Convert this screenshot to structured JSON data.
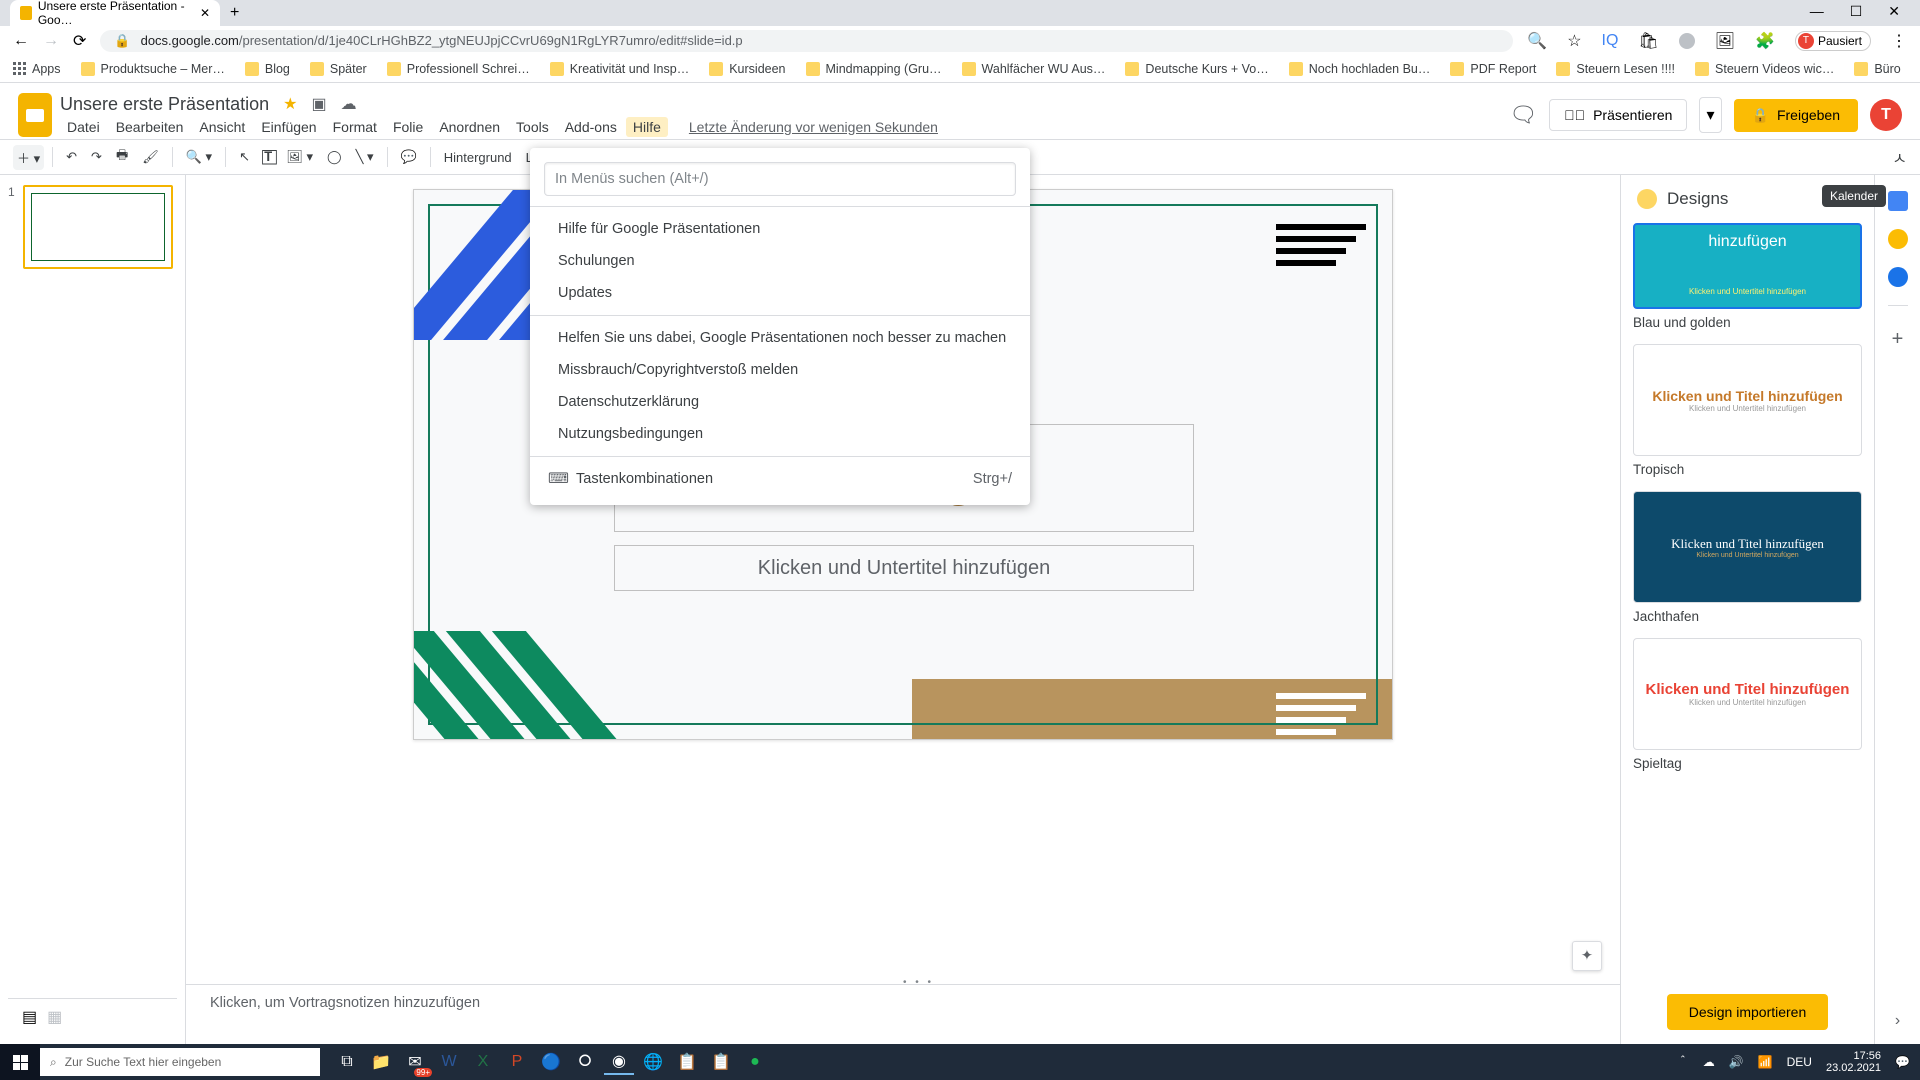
{
  "browser": {
    "tab_title": "Unsere erste Präsentation - Goo…",
    "url_prefix": "docs.google.com",
    "url_path": "/presentation/d/1je40CLrHGhBZ2_ytgNEUJpjCCvrU69gN1RgLYR7umro/edit#slide=id.p",
    "profile_label": "Pausiert",
    "window_min": "—",
    "window_max": "☐",
    "window_close": "✕"
  },
  "bookmarks": {
    "apps": "Apps",
    "items": [
      "Produktsuche – Mer…",
      "Blog",
      "Später",
      "Professionell Schrei…",
      "Kreativität und Insp…",
      "Kursideen",
      "Mindmapping (Gru…",
      "Wahlfächer WU Aus…",
      "Deutsche Kurs + Vo…",
      "Noch hochladen Bu…",
      "PDF Report",
      "Steuern Lesen !!!!",
      "Steuern Videos wic…",
      "Büro"
    ]
  },
  "doc": {
    "title": "Unsere erste Präsentation",
    "last_edit": "Letzte Änderung vor wenigen Sekunden"
  },
  "menubar": {
    "file": "Datei",
    "edit": "Bearbeiten",
    "view": "Ansicht",
    "insert": "Einfügen",
    "format": "Format",
    "slide": "Folie",
    "arrange": "Anordnen",
    "tools": "Tools",
    "addons": "Add-ons",
    "help": "Hilfe"
  },
  "header_actions": {
    "present": "Präsentieren",
    "share": "Freigeben"
  },
  "toolbar": {
    "background": "Hintergrund",
    "layout": "Layout"
  },
  "help_menu": {
    "search_placeholder": "In Menüs suchen (Alt+/)",
    "help_docs": "Hilfe für Google Präsentationen",
    "training": "Schulungen",
    "updates": "Updates",
    "improve": "Helfen Sie uns dabei, Google Präsentationen noch besser zu machen",
    "report": "Missbrauch/Copyrightverstoß melden",
    "privacy": "Datenschutzerklärung",
    "terms": "Nutzungsbedingungen",
    "shortcuts": "Tastenkombinationen",
    "shortcuts_key": "Strg+/"
  },
  "slide": {
    "title_placeholder": "hinzufügen",
    "subtitle_placeholder": "Klicken und Untertitel hinzufügen"
  },
  "notes": {
    "placeholder": "Klicken, um Vortragsnotizen hinzuzufügen"
  },
  "filmstrip": {
    "slide1_num": "1"
  },
  "designs": {
    "title": "Designs",
    "import": "Design importieren",
    "tooltip": "Kalender",
    "themes": [
      {
        "name": "Blau und golden",
        "title_text": "hinzufügen",
        "sub_text": "Klicken und Untertitel hinzufügen"
      },
      {
        "name": "Tropisch",
        "title_text": "Klicken und Titel hinzufügen",
        "sub_text": "Klicken und Untertitel hinzufügen"
      },
      {
        "name": "Jachthafen",
        "title_text": "Klicken und Titel hinzufügen",
        "sub_text": "Klicken und Untertitel hinzufügen"
      },
      {
        "name": "Spieltag",
        "title_text": "Klicken und Titel hinzufügen",
        "sub_text": "Klicken und Untertitel hinzufügen"
      }
    ]
  },
  "taskbar": {
    "search_placeholder": "Zur Suche Text hier eingeben",
    "lang": "DEU",
    "time": "17:56",
    "date": "23.02.2021",
    "notif": "99+"
  }
}
